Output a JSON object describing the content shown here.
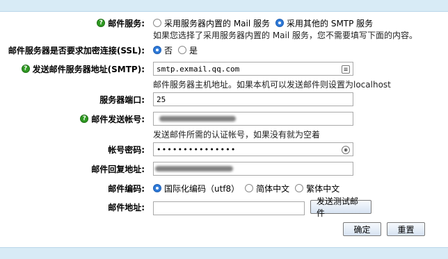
{
  "mail_service": {
    "label": "邮件服务:",
    "option_builtin": "采用服务器内置的 Mail 服务",
    "option_smtp": "采用其他的 SMTP 服务",
    "hint": "如果您选择了采用服务器内置的 Mail 服务，您不需要填写下面的内容。"
  },
  "ssl": {
    "label": "邮件服务器是否要求加密连接(SSL):",
    "option_no": "否",
    "option_yes": "是"
  },
  "smtp_host": {
    "label": "发送邮件服务器地址(SMTP):",
    "value": "smtp.exmail.qq.com",
    "hint": "邮件服务器主机地址。如果本机可以发送邮件则设置为localhost"
  },
  "port": {
    "label": "服务器端口:",
    "value": "25"
  },
  "account": {
    "label": "邮件发送帐号:",
    "hint": "发送邮件所需的认证帐号，如果没有就为空着"
  },
  "password": {
    "label": "帐号密码:",
    "value": "•••••••••••••••"
  },
  "reply": {
    "label": "邮件回复地址:"
  },
  "encoding": {
    "label": "邮件编码:",
    "option_utf8": "国际化编码（utf8）",
    "option_gb": "简体中文",
    "option_big5": "繁体中文"
  },
  "mail_address": {
    "label": "邮件地址:",
    "value": "",
    "test_button": "发送测试邮件"
  },
  "buttons": {
    "confirm": "确定",
    "reset": "重置"
  }
}
